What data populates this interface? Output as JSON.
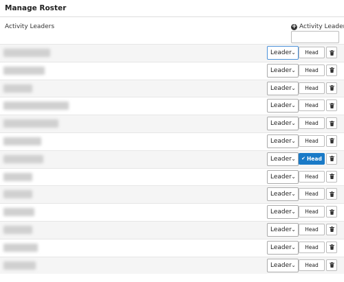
{
  "header": {
    "title": "Manage Roster"
  },
  "section": {
    "label": "Activity Leaders"
  },
  "add_control": {
    "label": "Activity Leaders",
    "icon": "plus-circle-icon",
    "input_value": ""
  },
  "colors": {
    "accent": "#1a7ac7",
    "row_alt": "#f5f5f5",
    "border": "#dcdcdc"
  },
  "rows": [
    {
      "role": "Leader",
      "head_label": "Head",
      "head_active": false,
      "focused": true
    },
    {
      "role": "Leader",
      "head_label": "Head",
      "head_active": false
    },
    {
      "role": "Leader",
      "head_label": "Head",
      "head_active": false
    },
    {
      "role": "Leader",
      "head_label": "Head",
      "head_active": false
    },
    {
      "role": "Leader",
      "head_label": "Head",
      "head_active": false
    },
    {
      "role": "Leader",
      "head_label": "Head",
      "head_active": false
    },
    {
      "role": "Leader",
      "head_label": "Head",
      "head_active": true
    },
    {
      "role": "Leader",
      "head_label": "Head",
      "head_active": false
    },
    {
      "role": "Leader",
      "head_label": "Head",
      "head_active": false
    },
    {
      "role": "Leader",
      "head_label": "Head",
      "head_active": false
    },
    {
      "role": "Leader",
      "head_label": "Head",
      "head_active": false
    },
    {
      "role": "Leader",
      "head_label": "Head",
      "head_active": false
    },
    {
      "role": "Leader",
      "head_label": "Head",
      "head_active": false
    }
  ]
}
